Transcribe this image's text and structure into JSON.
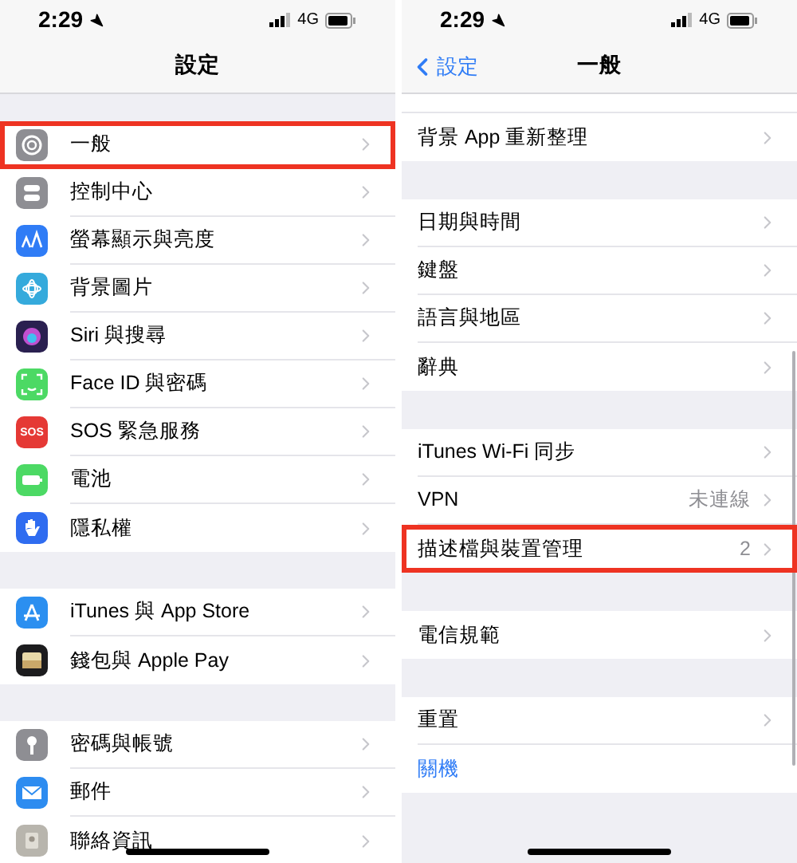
{
  "screens": [
    {
      "status_bar": {
        "time": "2:29",
        "network": "4G"
      },
      "nav": {
        "title": "設定"
      },
      "sections": [
        {
          "rows": [
            {
              "label": "一般",
              "highlighted": true,
              "color": "#8e8e93"
            },
            {
              "label": "控制中心",
              "highlighted": false,
              "color": "#8e8e93"
            },
            {
              "label": "螢幕顯示與亮度",
              "highlighted": false,
              "color": "#2f7cf6"
            },
            {
              "label": "背景圖片",
              "highlighted": false,
              "color": "#35aadc"
            },
            {
              "label": "Siri 與搜尋",
              "highlighted": false,
              "color": "#2a2050"
            },
            {
              "label": "Face ID 與密碼",
              "highlighted": false,
              "color": "#4cd964"
            },
            {
              "label": "SOS 緊急服務",
              "highlighted": false,
              "color": "#e53935",
              "icon_text": "SOS"
            },
            {
              "label": "電池",
              "highlighted": false,
              "color": "#4cd964"
            },
            {
              "label": "隱私權",
              "highlighted": false,
              "color": "#2f6cf0"
            }
          ]
        },
        {
          "rows": [
            {
              "label": "iTunes 與 App Store",
              "highlighted": false,
              "color": "#2b8ff0"
            },
            {
              "label": "錢包與 Apple Pay",
              "highlighted": false,
              "color": "#1c1c1e"
            }
          ]
        },
        {
          "rows": [
            {
              "label": "密碼與帳號",
              "highlighted": false,
              "color": "#8e8e93"
            },
            {
              "label": "郵件",
              "highlighted": false,
              "color": "#2d8cf0"
            },
            {
              "label": "聯絡資訊",
              "highlighted": false,
              "color": "#b8b5ad"
            }
          ]
        }
      ]
    },
    {
      "status_bar": {
        "time": "2:29",
        "network": "4G"
      },
      "nav": {
        "title": "一般",
        "back": "設定"
      },
      "sections": [
        {
          "rows": [
            {
              "label": "背景 App 重新整理",
              "highlighted": false
            }
          ]
        },
        {
          "rows": [
            {
              "label": "日期與時間",
              "highlighted": false
            },
            {
              "label": "鍵盤",
              "highlighted": false
            },
            {
              "label": "語言與地區",
              "highlighted": false
            },
            {
              "label": "辭典",
              "highlighted": false
            }
          ]
        },
        {
          "rows": [
            {
              "label": "iTunes Wi-Fi 同步",
              "highlighted": false
            },
            {
              "label": "VPN",
              "value": "未連線",
              "highlighted": false
            },
            {
              "label": "描述檔與裝置管理",
              "value": "2",
              "highlighted": true
            }
          ]
        },
        {
          "rows": [
            {
              "label": "電信規範",
              "highlighted": false
            }
          ]
        },
        {
          "rows": [
            {
              "label": "重置",
              "highlighted": false
            },
            {
              "label": "關機",
              "kind": "action",
              "highlighted": false
            }
          ]
        }
      ]
    }
  ]
}
